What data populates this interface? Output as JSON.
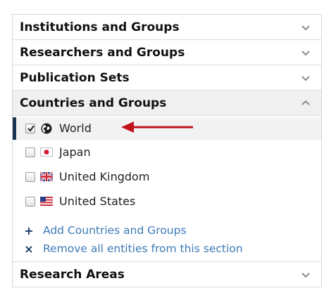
{
  "sections": {
    "institutions": {
      "title": "Institutions and Groups",
      "icon": "chevron-down-icon"
    },
    "researchers": {
      "title": "Researchers and Groups",
      "icon": "chevron-down-icon"
    },
    "publications": {
      "title": "Publication Sets",
      "icon": "chevron-down-icon"
    },
    "countries": {
      "title": "Countries and Groups",
      "icon": "chevron-up-icon",
      "entities": [
        {
          "label": "World",
          "checked": true,
          "icon": "globe-icon"
        },
        {
          "label": "Japan",
          "checked": false,
          "icon": "japan-flag-icon"
        },
        {
          "label": "United Kingdom",
          "checked": false,
          "icon": "uk-flag-icon"
        },
        {
          "label": "United States",
          "checked": false,
          "icon": "us-flag-icon"
        }
      ],
      "add_label": "Add Countries and Groups",
      "remove_label": "Remove all entities from this section"
    },
    "research_areas": {
      "title": "Research Areas",
      "icon": "chevron-down-icon"
    }
  },
  "colors": {
    "link": "#3d7ab8",
    "selected_bar": "#1a3550",
    "annotation_arrow": "#c0141a"
  }
}
